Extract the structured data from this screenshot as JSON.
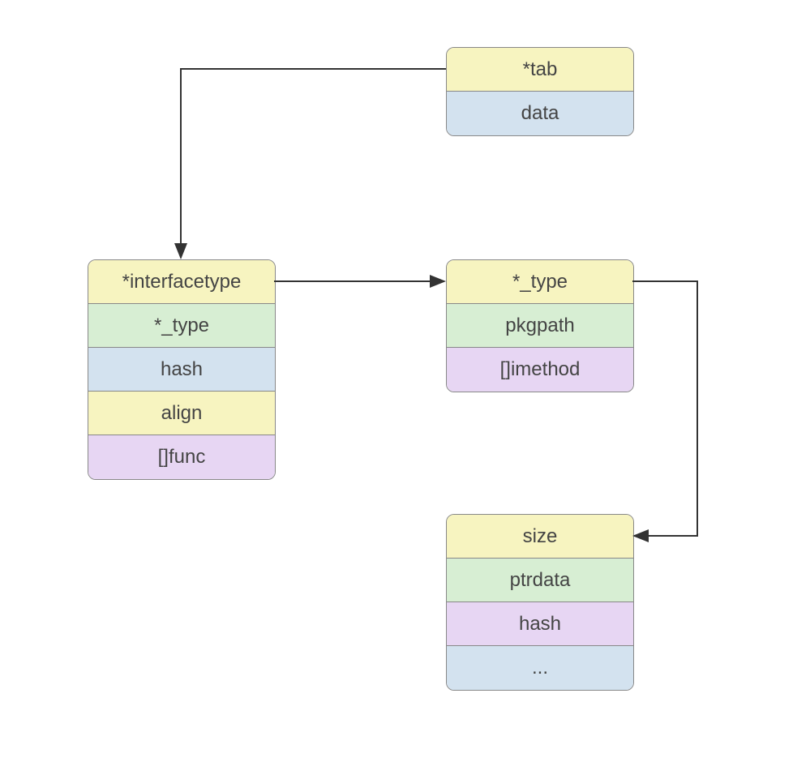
{
  "boxes": {
    "iface": {
      "rows": [
        {
          "label": "*tab",
          "color": "yellow"
        },
        {
          "label": "data",
          "color": "blue"
        }
      ]
    },
    "itab": {
      "rows": [
        {
          "label": "*interfacetype",
          "color": "yellow"
        },
        {
          "label": "*_type",
          "color": "green"
        },
        {
          "label": "hash",
          "color": "blue"
        },
        {
          "label": "align",
          "color": "yellow"
        },
        {
          "label": "[]func",
          "color": "purple"
        }
      ]
    },
    "interfacetype": {
      "rows": [
        {
          "label": "*_type",
          "color": "yellow"
        },
        {
          "label": "pkgpath",
          "color": "green"
        },
        {
          "label": "[]imethod",
          "color": "purple"
        }
      ]
    },
    "rtype": {
      "rows": [
        {
          "label": "size",
          "color": "yellow"
        },
        {
          "label": "ptrdata",
          "color": "green"
        },
        {
          "label": "hash",
          "color": "purple"
        },
        {
          "label": "...",
          "color": "blue"
        }
      ]
    }
  },
  "colors": {
    "yellow": "#f7f4c0",
    "blue": "#d3e2ef",
    "green": "#d7eed3",
    "purple": "#e7d6f3",
    "border": "#888888",
    "arrow": "#333333"
  }
}
